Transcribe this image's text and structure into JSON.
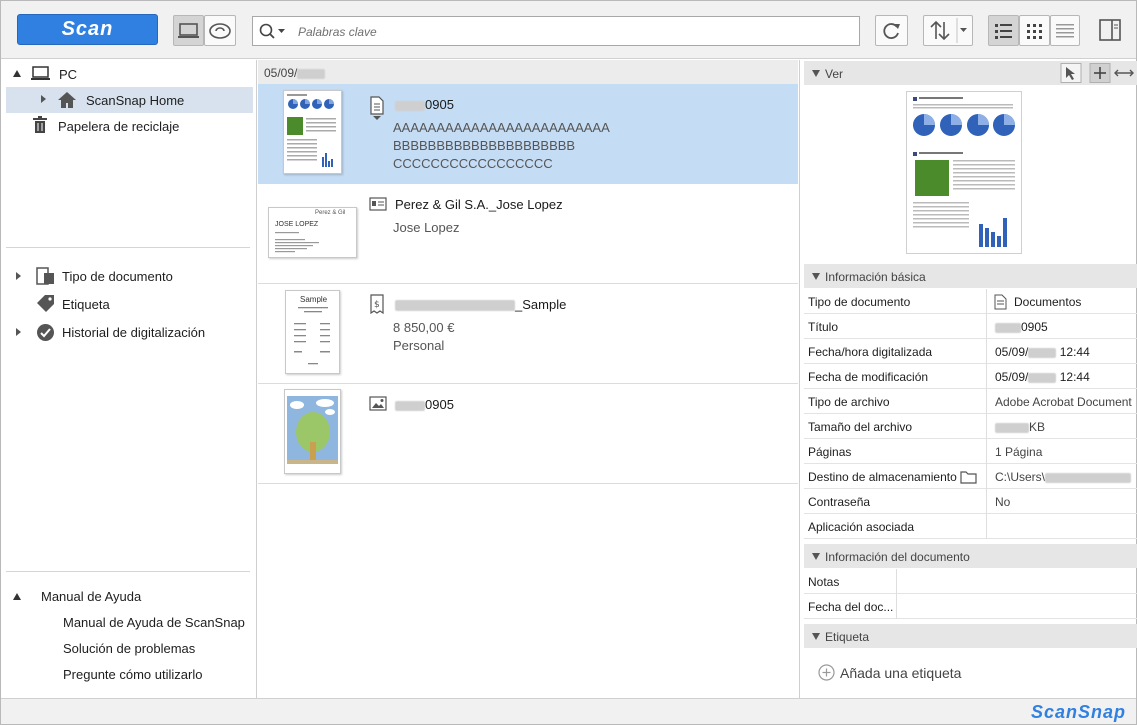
{
  "toolbar": {
    "scan_label": "Scan",
    "search_placeholder": "Palabras clave"
  },
  "sidebar": {
    "pc": "PC",
    "scansnap_home": "ScanSnap Home",
    "recycle": "Papelera de reciclaje",
    "doc_type": "Tipo de documento",
    "tag": "Etiqueta",
    "history": "Historial de digitalización",
    "help": {
      "title": "Manual de Ayuda",
      "items": [
        "Manual de Ayuda de ScanSnap",
        "Solución de problemas",
        "Pregunte cómo utilizarlo"
      ]
    }
  },
  "list": {
    "date_header": "05/09/",
    "items": [
      {
        "title_suffix": "0905",
        "lines": [
          "AAAAAAAAAAAAAAAAAAAAAAAAA",
          "BBBBBBBBBBBBBBBBBBBBB",
          "CCCCCCCCCCCCCCCCC"
        ]
      },
      {
        "title": "Perez & Gil S.A._Jose Lopez",
        "lines": [
          "Jose Lopez"
        ],
        "card": {
          "company": "Perez & Gil",
          "name": "JOSE LOPEZ"
        }
      },
      {
        "title_suffix": "_Sample",
        "lines": [
          "8 850,00 €",
          "Personal"
        ],
        "receipt_title": "Sample"
      },
      {
        "title_suffix": "0905",
        "lines": []
      }
    ]
  },
  "preview": {
    "header": "Ver"
  },
  "basic_info": {
    "header": "Información básica",
    "rows": [
      {
        "key": "Tipo de documento",
        "value": "Documentos"
      },
      {
        "key": "Título",
        "value": "0905"
      },
      {
        "key": "Fecha/hora digitalizada",
        "value_pre": "05/09/",
        "value_post": "12:44"
      },
      {
        "key": "Fecha de modificación",
        "value_pre": "05/09/",
        "value_post": "12:44"
      },
      {
        "key": "Tipo de archivo",
        "value": "Adobe Acrobat Document"
      },
      {
        "key": "Tamaño del archivo",
        "value": "KB"
      },
      {
        "key": "Páginas",
        "value": "1 Página"
      },
      {
        "key": "Destino de almacenamiento",
        "value": "C:\\Users\\"
      },
      {
        "key": "Contraseña",
        "value": "No"
      },
      {
        "key": "Aplicación asociada",
        "value": ""
      }
    ]
  },
  "doc_info": {
    "header": "Información del documento",
    "rows": [
      {
        "key": "Notas",
        "value": ""
      },
      {
        "key": "Fecha del doc...",
        "value": ""
      }
    ]
  },
  "tag_section": {
    "header": "Etiqueta",
    "add_label": "Añada una etiqueta"
  },
  "status": {
    "logo": "ScanSnap"
  },
  "colors": {
    "accent": "#2f80e0",
    "selection": "#c5dcf5"
  }
}
